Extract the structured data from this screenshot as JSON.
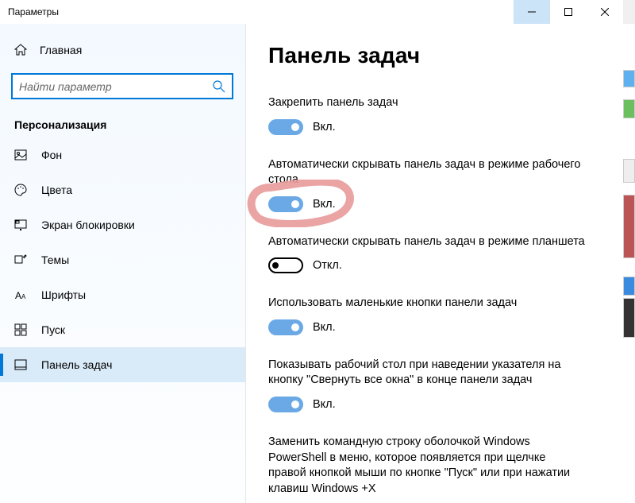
{
  "window": {
    "title": "Параметры"
  },
  "sidebar": {
    "home": "Главная",
    "search_placeholder": "Найти параметр",
    "section": "Персонализация",
    "items": [
      {
        "label": "Фон"
      },
      {
        "label": "Цвета"
      },
      {
        "label": "Экран блокировки"
      },
      {
        "label": "Темы"
      },
      {
        "label": "Шрифты"
      },
      {
        "label": "Пуск"
      },
      {
        "label": "Панель задач"
      }
    ]
  },
  "page": {
    "title": "Панель задач",
    "settings": [
      {
        "label": "Закрепить панель задач",
        "on": true,
        "state": "Вкл."
      },
      {
        "label": "Автоматически скрывать панель задач в режиме рабочего стола",
        "on": true,
        "state": "Вкл."
      },
      {
        "label": "Автоматически скрывать панель задач в режиме планшета",
        "on": false,
        "state": "Откл."
      },
      {
        "label": "Использовать маленькие кнопки панели задач",
        "on": true,
        "state": "Вкл."
      },
      {
        "label": "Показывать рабочий стол при наведении указателя на кнопку \"Свернуть все окна\" в конце панели задач",
        "on": true,
        "state": "Вкл."
      },
      {
        "label": "Заменить командную строку оболочкой Windows PowerShell в меню, которое появляется при щелчке правой кнопкой мыши по кнопке \"Пуск\" или при нажатии клавиш Windows +X",
        "on": null,
        "state": ""
      }
    ]
  }
}
